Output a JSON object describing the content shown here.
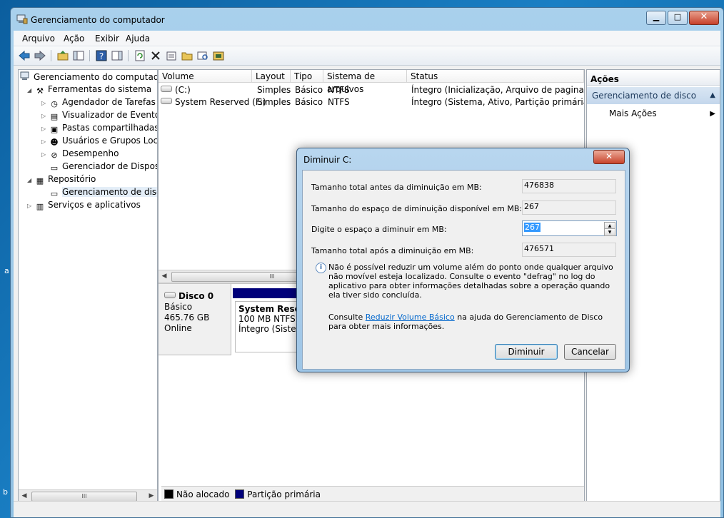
{
  "desktop": {
    "left_char": "a",
    "bottom_char": "b"
  },
  "window": {
    "title": "Gerenciamento do computador",
    "controls": {
      "minimize": "▁",
      "maximize": "□",
      "close": "✕"
    }
  },
  "menu": [
    "Arquivo",
    "Ação",
    "Exibir",
    "Ajuda"
  ],
  "tree": {
    "root": "Gerenciamento do computado",
    "items": [
      {
        "label": "Ferramentas do sistema",
        "icon": "tools-icon",
        "glyph": "⚒"
      },
      {
        "label": "Agendador de Tarefas",
        "icon": "clock-icon",
        "glyph": "◷"
      },
      {
        "label": "Visualizador de Eventos",
        "icon": "event-viewer-icon",
        "glyph": "▤"
      },
      {
        "label": "Pastas compartilhadas",
        "icon": "shared-folder-icon",
        "glyph": "▣"
      },
      {
        "label": "Usuários e Grupos Loca",
        "icon": "users-icon",
        "glyph": "☻"
      },
      {
        "label": "Desempenho",
        "icon": "performance-icon",
        "glyph": "⊘"
      },
      {
        "label": "Gerenciador de Disposit",
        "icon": "device-manager-icon",
        "glyph": "▭"
      },
      {
        "label": "Repositório",
        "icon": "storage-icon",
        "glyph": "▦"
      },
      {
        "label": "Gerenciamento de disco",
        "icon": "disk-management-icon",
        "glyph": "▭"
      },
      {
        "label": "Serviços e aplicativos",
        "icon": "services-icon",
        "glyph": "▥"
      }
    ],
    "scroll_grip": "III"
  },
  "volumes": {
    "columns": [
      "Volume",
      "Layout",
      "Tipo",
      "Sistema de arquivos",
      "Status"
    ],
    "rows": [
      {
        "volume": "(C:)",
        "layout": "Simples",
        "tipo": "Básico",
        "fs": "NTFS",
        "status": "Íntegro (Inicialização, Arquivo de paginação, D"
      },
      {
        "volume": "System Reserved (F:)",
        "layout": "Simples",
        "tipo": "Básico",
        "fs": "NTFS",
        "status": "Íntegro (Sistema, Ativo, Partição primária)"
      }
    ],
    "scroll_grip": "III"
  },
  "disk": {
    "name": "Disco 0",
    "type": "Básico",
    "size": "465.76 GB",
    "state": "Online",
    "partition": {
      "name": "System Reserve",
      "size": "100 MB NTFS",
      "status": "Íntegro (Sistema,"
    }
  },
  "legend": [
    {
      "label": "Não alocado",
      "color": "#000000"
    },
    {
      "label": "Partição primária",
      "color": "#00007a"
    }
  ],
  "actions": {
    "header": "Ações",
    "section": "Gerenciamento de disco",
    "more": "Mais Ações"
  },
  "dialog": {
    "title": "Diminuir C:",
    "close": "✕",
    "fields": [
      {
        "label": "Tamanho total antes da diminuição em MB:",
        "value": "476838"
      },
      {
        "label": "Tamanho do espaço de diminuição disponível em MB:",
        "value": "267"
      },
      {
        "label": "Digite o espaço a diminuir em MB:",
        "value": "267"
      },
      {
        "label": "Tamanho total após a diminuição em MB:",
        "value": "476571"
      }
    ],
    "info": "Não é possível reduzir um volume além do ponto onde qualquer arquivo não movível esteja localizado. Consulte o evento \"defrag\" no log do aplicativo para obter informações detalhadas sobre a operação quando ela tiver sido concluída.",
    "consult_prefix": "Consulte",
    "consult_link": "Reduzir Volume Básico",
    "consult_suffix": "na ajuda do Gerenciamento de Disco para obter mais informações.",
    "ok": "Diminuir",
    "cancel": "Cancelar"
  }
}
